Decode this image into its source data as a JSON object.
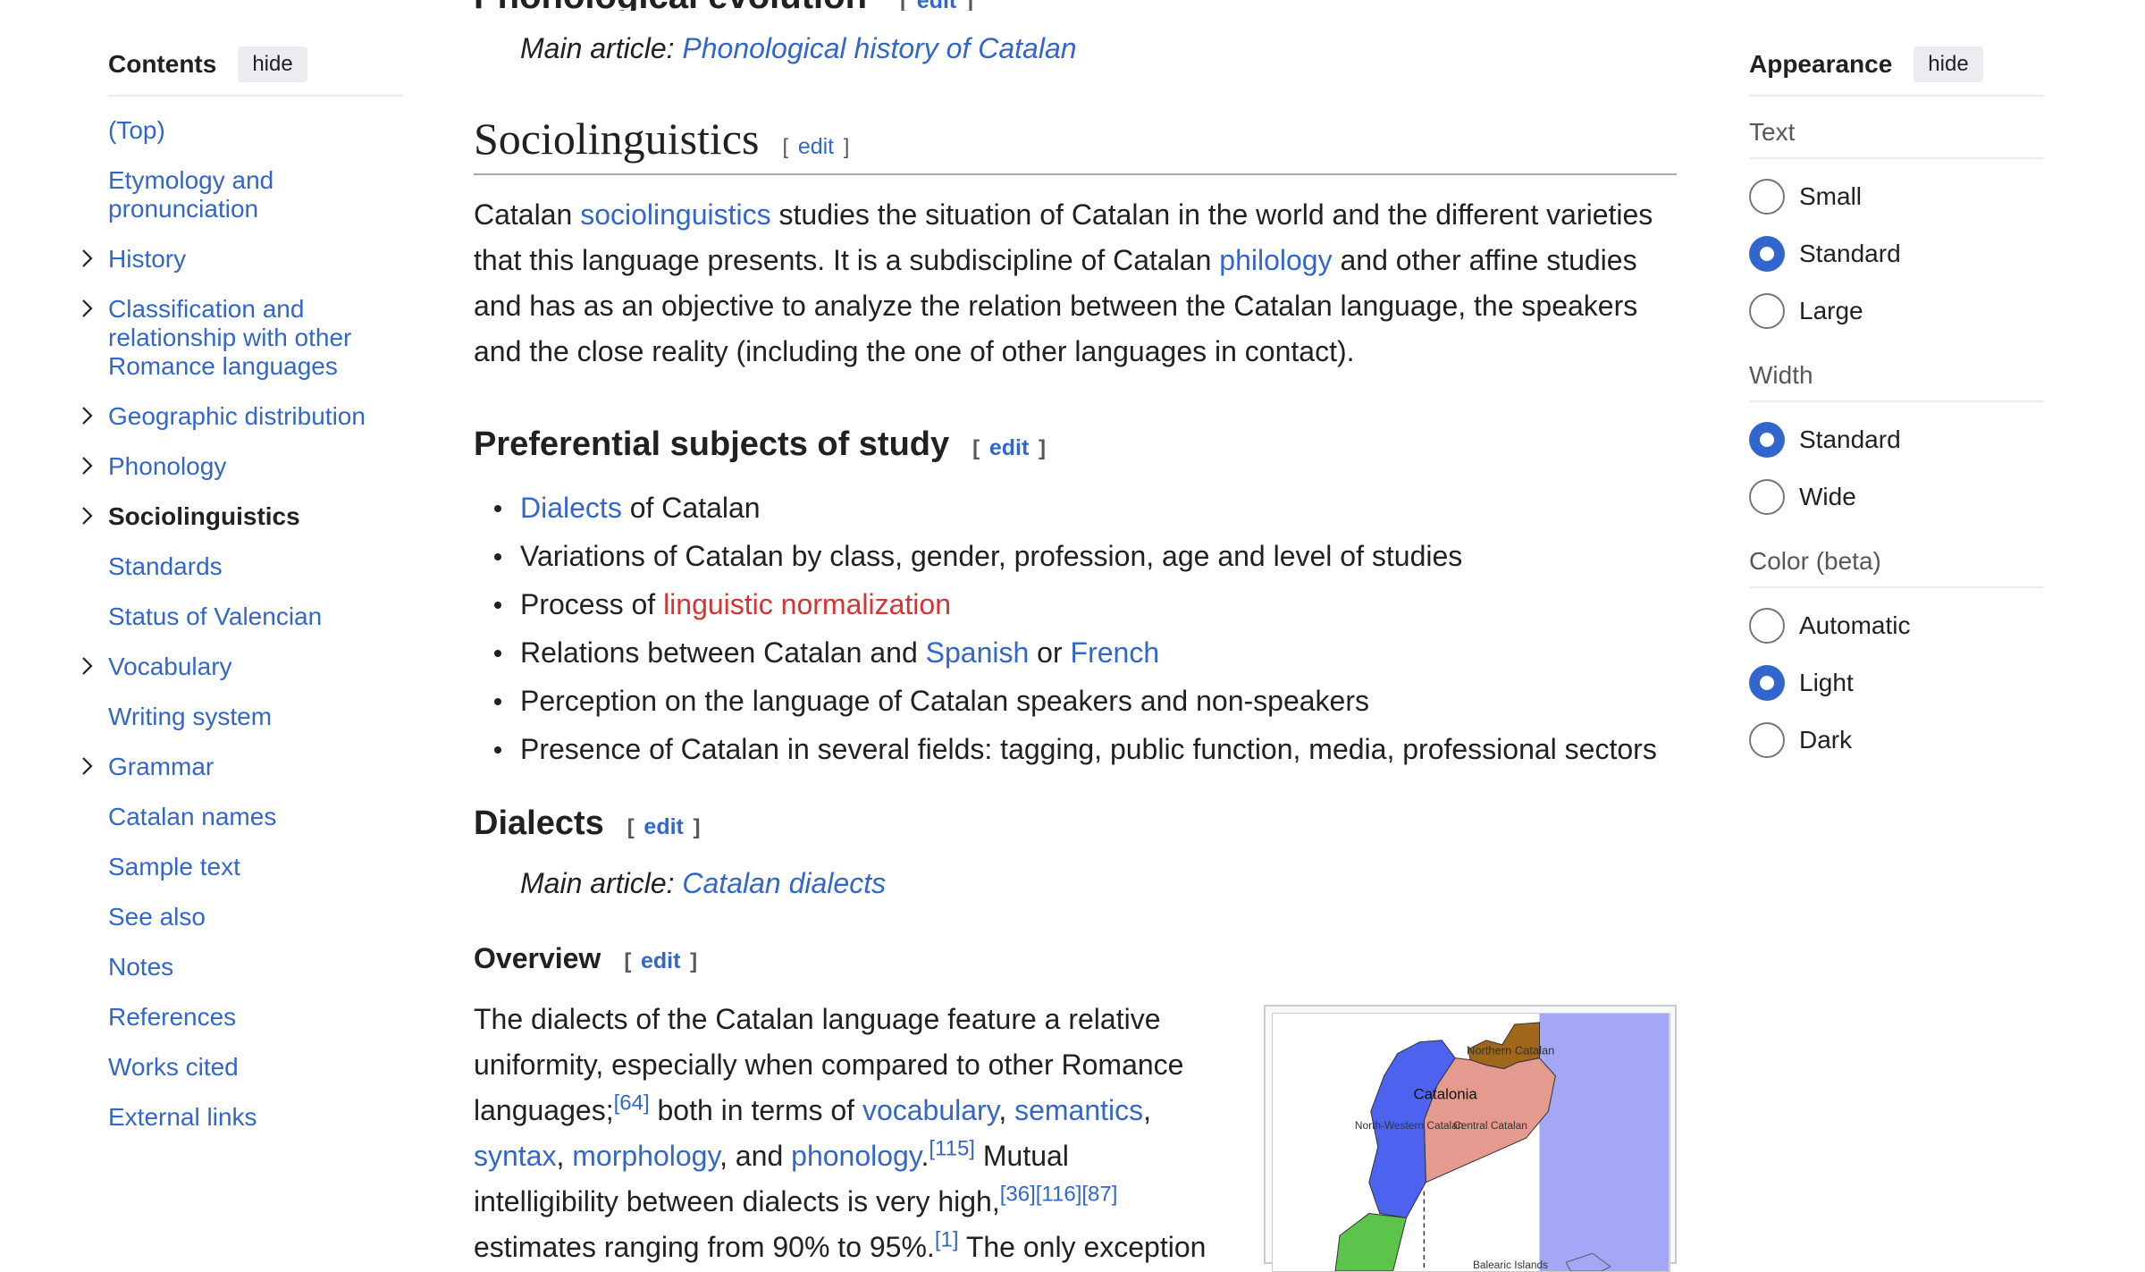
{
  "toc": {
    "title": "Contents",
    "hide_label": "hide",
    "items": [
      {
        "label": "(Top)",
        "expandable": false,
        "active": false
      },
      {
        "label": "Etymology and pronunciation",
        "expandable": false,
        "active": false
      },
      {
        "label": "History",
        "expandable": true,
        "active": false
      },
      {
        "label": "Classification and relationship with other Romance languages",
        "expandable": true,
        "active": false
      },
      {
        "label": "Geographic distribution",
        "expandable": true,
        "active": false
      },
      {
        "label": "Phonology",
        "expandable": true,
        "active": false
      },
      {
        "label": "Sociolinguistics",
        "expandable": true,
        "active": true
      },
      {
        "label": "Standards",
        "expandable": false,
        "active": false
      },
      {
        "label": "Status of Valencian",
        "expandable": false,
        "active": false
      },
      {
        "label": "Vocabulary",
        "expandable": true,
        "active": false
      },
      {
        "label": "Writing system",
        "expandable": false,
        "active": false
      },
      {
        "label": "Grammar",
        "expandable": true,
        "active": false
      },
      {
        "label": "Catalan names",
        "expandable": false,
        "active": false
      },
      {
        "label": "Sample text",
        "expandable": false,
        "active": false
      },
      {
        "label": "See also",
        "expandable": false,
        "active": false
      },
      {
        "label": "Notes",
        "expandable": false,
        "active": false
      },
      {
        "label": "References",
        "expandable": false,
        "active": false
      },
      {
        "label": "Works cited",
        "expandable": false,
        "active": false
      },
      {
        "label": "External links",
        "expandable": false,
        "active": false
      }
    ]
  },
  "article": {
    "prev_heading": "Phonological evolution",
    "prev_edit": "edit",
    "hatnote1": {
      "prefix": "Main article: ",
      "link": "Phonological history of Catalan"
    },
    "section_title": "Sociolinguistics",
    "edit_label": "edit",
    "para1": {
      "t1": "Catalan ",
      "l1": "sociolinguistics",
      "t2": " studies the situation of Catalan in the world and the different varieties that this language presents. It is a subdiscipline of Catalan ",
      "l2": "philology",
      "t3": " and other affine studies and has as an objective to analyze the relation between the Catalan language, the speakers and the close reality (including the one of other languages in contact)."
    },
    "subsection1": "Preferential subjects of study",
    "bullets": {
      "b1_link": "Dialects",
      "b1_text": " of Catalan",
      "b2": "Variations of Catalan by class, gender, profession, age and level of studies",
      "b3_text": "Process of ",
      "b3_redlink": "linguistic normalization",
      "b4_text1": "Relations between Catalan and ",
      "b4_link1": "Spanish",
      "b4_text2": " or ",
      "b4_link2": "French",
      "b5": "Perception on the language of Catalan speakers and non-speakers",
      "b6": "Presence of Catalan in several fields: tagging, public function, media, professional sectors"
    },
    "subsection2": "Dialects",
    "hatnote2": {
      "prefix": "Main article: ",
      "link": "Catalan dialects"
    },
    "subsection3": "Overview",
    "para2": {
      "t1": "The dialects of the Catalan language feature a relative uniformity, especially when compared to other Romance languages;",
      "ref1": "[64]",
      "t2": " both in terms of ",
      "l1": "vocabulary",
      "t3": ", ",
      "l2": "semantics",
      "t4": ", ",
      "l3": "syntax",
      "t5": ", ",
      "l4": "morphology",
      "t6": ", and ",
      "l5": "phonology",
      "t7": ".",
      "ref2": "[115]",
      "t8": " Mutual intelligibility between dialects is very high,",
      "ref3": "[36][116][87]",
      "t9": " estimates ranging from 90% to 95%.",
      "ref4": "[1]",
      "t10": " The only exception"
    },
    "map": {
      "labels": [
        "Northern Catalan",
        "Catalonia",
        "North-Western Catalan",
        "Central Catalan",
        "Balearic Islands"
      ],
      "colors": {
        "sea": "#a3a7f5",
        "northern": "#a0661a",
        "central": "#e59a8f",
        "northwestern": "#4d63f0",
        "valencian": "#5cc44a"
      }
    }
  },
  "appearance": {
    "title": "Appearance",
    "hide_label": "hide",
    "text_title": "Text",
    "text_options": [
      {
        "label": "Small",
        "checked": false
      },
      {
        "label": "Standard",
        "checked": true
      },
      {
        "label": "Large",
        "checked": false
      }
    ],
    "width_title": "Width",
    "width_options": [
      {
        "label": "Standard",
        "checked": true
      },
      {
        "label": "Wide",
        "checked": false
      }
    ],
    "color_title": "Color (beta)",
    "color_options": [
      {
        "label": "Automatic",
        "checked": false
      },
      {
        "label": "Light",
        "checked": true
      },
      {
        "label": "Dark",
        "checked": false
      }
    ]
  }
}
